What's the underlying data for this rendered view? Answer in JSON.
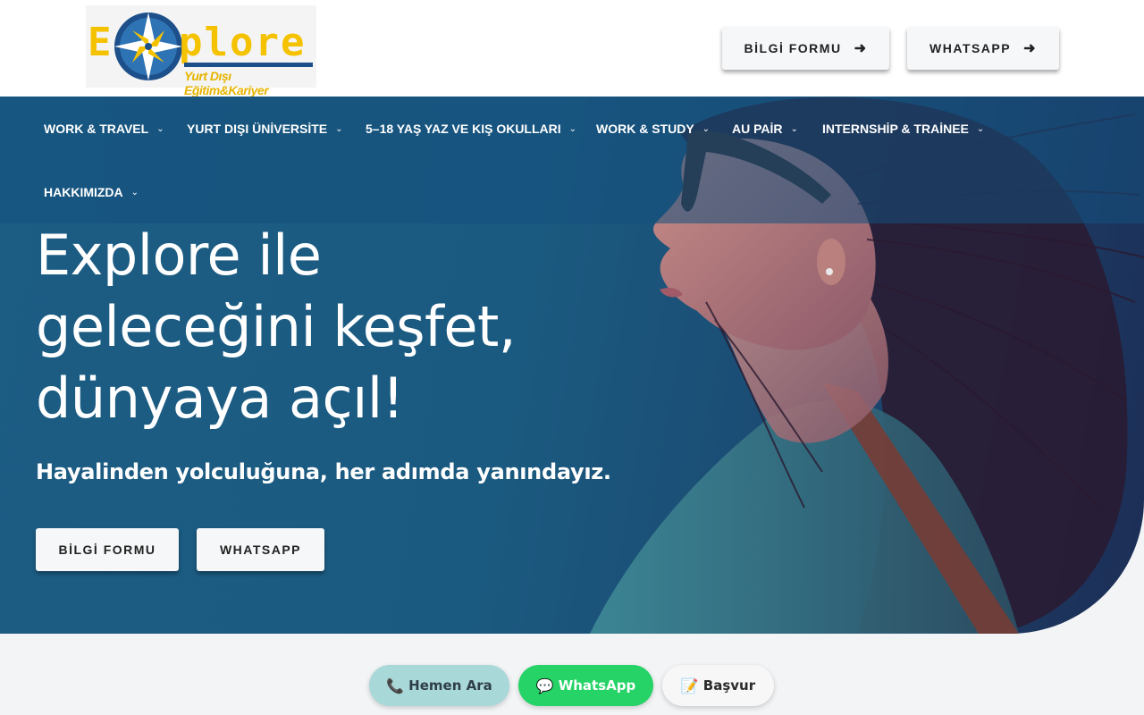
{
  "header": {
    "logo": {
      "wordmark": "plore",
      "initial": "E",
      "tagline": "Yurt Dışı Eğitim&Kariyer"
    },
    "buttons": [
      {
        "label": "BİLGİ FORMU",
        "icon": "arrow-right-icon"
      },
      {
        "label": "WHATSAPP",
        "icon": "arrow-right-icon"
      }
    ]
  },
  "nav": {
    "items": [
      {
        "label": "WORK & TRAVEL",
        "icon": "chevron-down-icon"
      },
      {
        "label": "YURT DIŞI ÜNİVERSİTE",
        "icon": "chevron-down-icon"
      },
      {
        "label": "5–18 YAŞ YAZ VE KIŞ OKULLARI",
        "icon": "chevron-down-icon"
      },
      {
        "label": "WORK & STUDY",
        "icon": "chevron-down-icon"
      },
      {
        "label": "AU PAİR",
        "icon": "chevron-down-icon"
      },
      {
        "label": "INTERNSHİP & TRAİNEE",
        "icon": "chevron-down-icon"
      },
      {
        "label": "HAKKIMIZDA",
        "icon": "chevron-down-icon"
      }
    ]
  },
  "hero": {
    "title_lines": [
      "Explore ile",
      "geleceğini keşfet,",
      "dünyaya açıl!"
    ],
    "subtitle": "Hayalinden yolculuğuna, her adımda yanındayız.",
    "buttons": [
      {
        "label": "BİLGİ FORMU"
      },
      {
        "label": "WHATSAPP"
      }
    ]
  },
  "floating": {
    "buttons": [
      {
        "label": "Hemen Ara",
        "icon": "📞"
      },
      {
        "label": "WhatsApp",
        "icon": "💬"
      },
      {
        "label": "Başvur",
        "icon": "📝"
      }
    ]
  },
  "colors": {
    "accent_yellow": "#f5c200",
    "brand_blue": "#1d4f8a",
    "hero_blue": "#1c5d84",
    "whatsapp_green": "#25d366",
    "call_teal": "#a8d8d8"
  }
}
